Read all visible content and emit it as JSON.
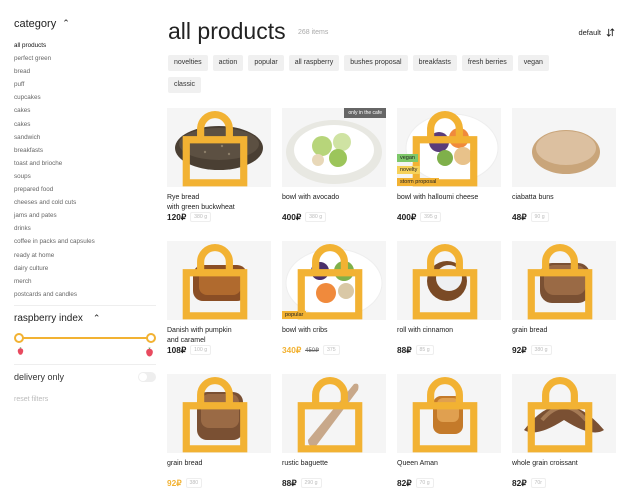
{
  "sidebar": {
    "category_title": "category",
    "categories": [
      "all products",
      "perfect green",
      "bread",
      "puff",
      "cupcakes",
      "cakes",
      "cakes",
      "sandwich",
      "breakfasts",
      "toast and brioche",
      "soups",
      "prepared food",
      "cheeses and cold cuts",
      "jams and pates",
      "drinks",
      "coffee in packs and capsules",
      "ready at home",
      "dairy culture",
      "merch",
      "postcards and candles"
    ],
    "raspberry_title": "raspberry index",
    "delivery_label": "delivery only",
    "reset_label": "reset filters"
  },
  "header": {
    "title": "all products",
    "count": "268 items",
    "sort_label": "default"
  },
  "filters": [
    "novelties",
    "action",
    "popular",
    "all raspberry",
    "bushes proposal",
    "breakfasts",
    "fresh berries",
    "vegan",
    "classic"
  ],
  "colors": {
    "accent": "#f2b233",
    "vegan_tag": "#7ec86a",
    "novelty_tag": "#f6d15a",
    "storm_tag": "#f2b233",
    "popular_tag": "#f2b233"
  },
  "products": [
    {
      "name_line1": "Rye bread",
      "name_line2": "with green buckwheat",
      "price": "120₽",
      "weight": "380 g"
    },
    {
      "name_line1": "bowl with avocado",
      "name_line2": "",
      "price": "400₽",
      "weight": "380 g",
      "badge": "only in the cafe"
    },
    {
      "name_line1": "bowl with halloumi cheese",
      "name_line2": "",
      "price": "400₽",
      "weight": "395 g",
      "tags": [
        "vegan",
        "novelty",
        "storm proposal"
      ]
    },
    {
      "name_line1": "ciabatta buns",
      "name_line2": "",
      "price": "48₽",
      "weight": "90 g"
    },
    {
      "name_line1": "Danish with pumpkin",
      "name_line2": "and caramel",
      "price": "108₽",
      "weight": "100 g"
    },
    {
      "name_line1": "bowl with cribs",
      "name_line2": "",
      "price": "340₽",
      "old_price": "450₽",
      "weight": "375",
      "tags": [
        "popular"
      ]
    },
    {
      "name_line1": "roll with cinnamon",
      "name_line2": "",
      "price": "88₽",
      "weight": "85 g"
    },
    {
      "name_line1": "grain bread",
      "name_line2": "",
      "price": "92₽",
      "weight": "380 g"
    },
    {
      "name_line1": "grain bread",
      "name_line2": "",
      "price": "92₽",
      "weight": "380"
    },
    {
      "name_line1": "rustic baguette",
      "name_line2": "",
      "price": "88₽",
      "weight": "290 g"
    },
    {
      "name_line1": "Queen Aman",
      "name_line2": "",
      "price": "82₽",
      "weight": "70 g"
    },
    {
      "name_line1": "whole grain croissant",
      "name_line2": "",
      "price": "82₽",
      "weight": "70г"
    }
  ]
}
